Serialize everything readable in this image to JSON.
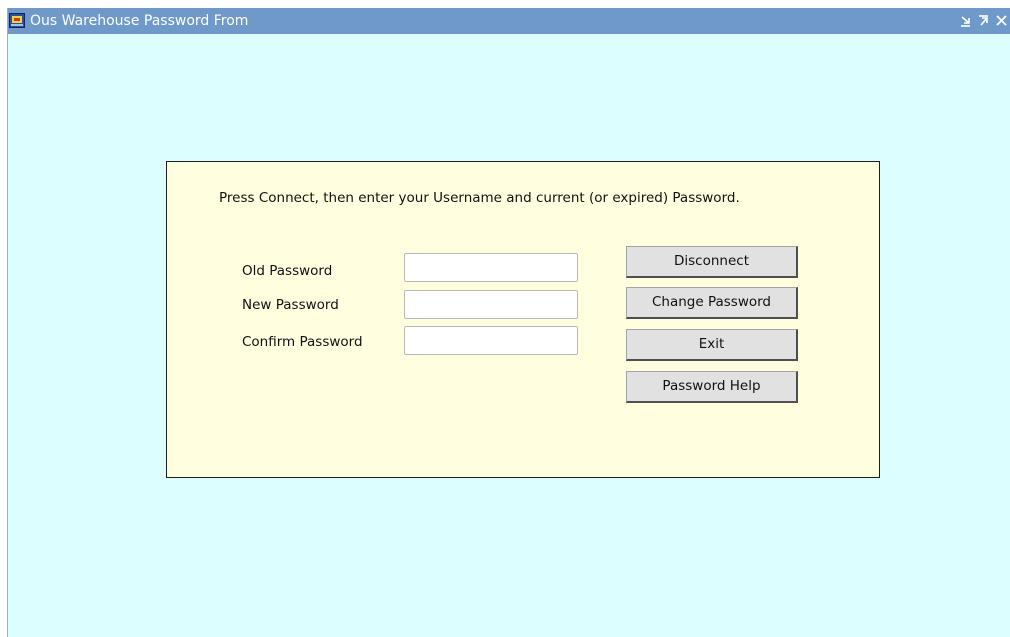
{
  "window": {
    "title": "Ous Warehouse Password From",
    "icon": "app-icon",
    "controls": [
      "minimize-icon",
      "maximize-icon",
      "close-icon"
    ]
  },
  "form": {
    "instruction": "Press Connect, then enter your Username and current (or expired) Password.",
    "fields": [
      {
        "label": "Old Password",
        "value": ""
      },
      {
        "label": "New Password",
        "value": ""
      },
      {
        "label": "Confirm Password",
        "value": ""
      }
    ],
    "buttons": [
      {
        "label": "Disconnect"
      },
      {
        "label": "Change Password"
      },
      {
        "label": "Exit"
      },
      {
        "label": "Password Help"
      }
    ]
  },
  "colors": {
    "titlebar": "#6e99c9",
    "window_bg": "#dcfefe",
    "panel_bg": "#ffffdf",
    "button_bg": "#e1e1e1"
  }
}
